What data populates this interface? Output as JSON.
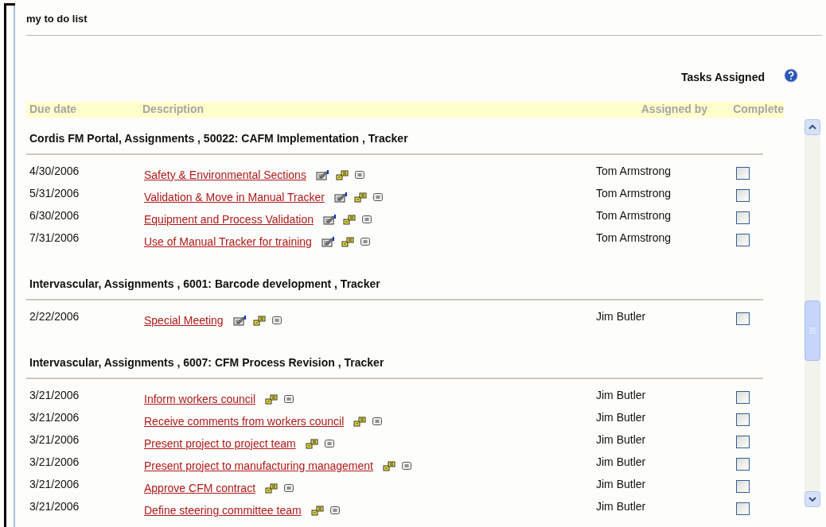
{
  "panel": {
    "title": "my to do list",
    "subtitle": "Tasks Assigned"
  },
  "table": {
    "columns": [
      "Due date",
      "Description",
      "Assigned by",
      "Complete"
    ],
    "groups": [
      {
        "heading": "Cordis FM Portal, Assignments , 50022: CAFM Implementation , Tracker",
        "rows": [
          {
            "due": "4/30/2006",
            "description": "Safety & Environmental Sections",
            "editable": true,
            "assigned_by": "Tom Armstrong",
            "complete": false
          },
          {
            "due": "5/31/2006",
            "description": "Validation & Move in Manual Tracker",
            "editable": true,
            "assigned_by": "Tom Armstrong",
            "complete": false
          },
          {
            "due": "6/30/2006",
            "description": "Equipment and Process Validation",
            "editable": true,
            "assigned_by": "Tom Armstrong",
            "complete": false
          },
          {
            "due": "7/31/2006",
            "description": "Use of Manual Tracker for training",
            "editable": true,
            "assigned_by": "Tom Armstrong",
            "complete": false
          }
        ]
      },
      {
        "heading": "Intervascular, Assignments , 6001: Barcode development , Tracker",
        "rows": [
          {
            "due": "2/22/2006",
            "description": "Special Meeting",
            "editable": true,
            "assigned_by": "Jim Butler",
            "complete": false
          }
        ]
      },
      {
        "heading": "Intervascular, Assignments , 6007: CFM Process Revision , Tracker",
        "rows": [
          {
            "due": "3/21/2006",
            "description": "Inform workers council",
            "editable": false,
            "assigned_by": "Jim Butler",
            "complete": false
          },
          {
            "due": "3/21/2006",
            "description": "Receive comments from workers council",
            "editable": false,
            "assigned_by": "Jim Butler",
            "complete": false
          },
          {
            "due": "3/21/2006",
            "description": "Present project to project team",
            "editable": false,
            "assigned_by": "Jim Butler",
            "complete": false
          },
          {
            "due": "3/21/2006",
            "description": "Present project to manufacturing management",
            "editable": false,
            "assigned_by": "Jim Butler",
            "complete": false
          },
          {
            "due": "3/21/2006",
            "description": "Approve CFM contract",
            "editable": false,
            "assigned_by": "Jim Butler",
            "complete": false
          },
          {
            "due": "3/21/2006",
            "description": "Define steering committee team",
            "editable": false,
            "assigned_by": "Jim Butler",
            "complete": false
          }
        ]
      }
    ]
  }
}
